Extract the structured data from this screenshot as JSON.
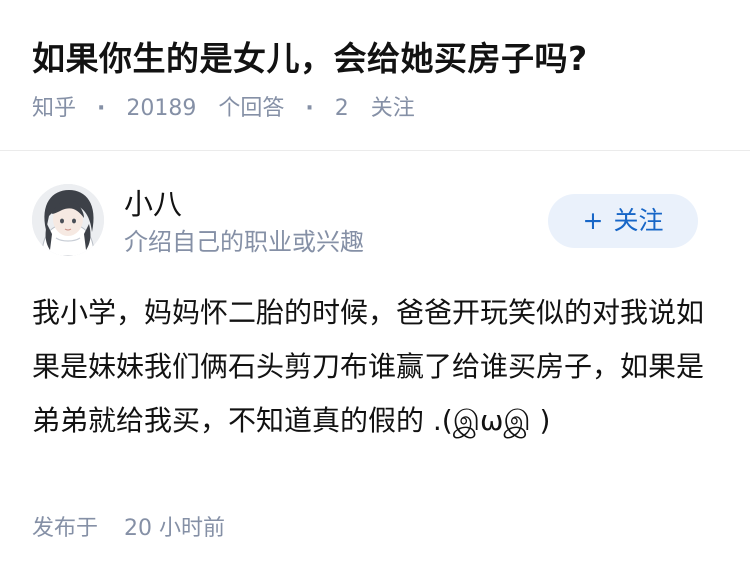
{
  "question": {
    "title": "如果你生的是女儿，会给她买房子吗?",
    "meta": {
      "source": "知乎",
      "separator": "·",
      "answer_count": "20189",
      "answer_label": "个回答",
      "follow_count": "2",
      "follow_label": "关注"
    }
  },
  "author": {
    "name": "小八",
    "headline": "介绍自己的职业或兴趣",
    "follow_button": {
      "icon": "+",
      "label": "关注"
    }
  },
  "answer": {
    "content": "我小学，妈妈怀二胎的时候，爸爸开玩笑似的对我说如果是妹妹我们俩石头剪刀布谁赢了给谁买房子，如果是弟弟就给我买，不知道真的假的 .(இωஇ )",
    "time": {
      "label": "发布于",
      "value": "20 小时前"
    }
  },
  "colors": {
    "meta_text": "#8590a6",
    "follow_button_bg": "#eaf1fb",
    "follow_button_text": "#1766c7"
  }
}
